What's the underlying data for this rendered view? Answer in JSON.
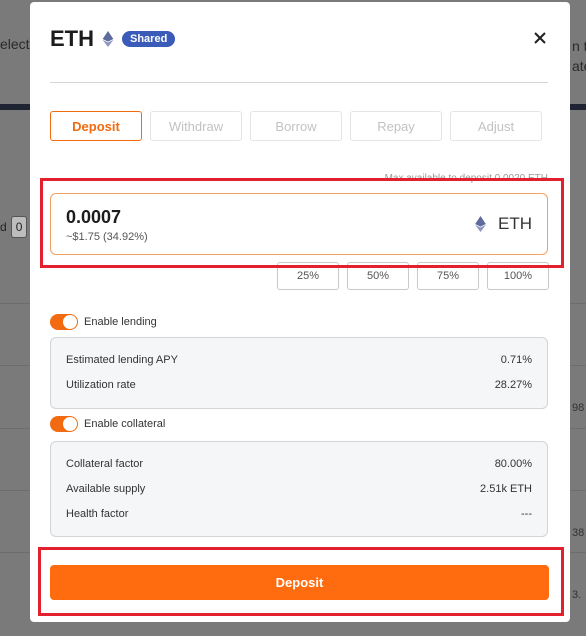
{
  "background": {
    "left_text": "elect",
    "left_chip_label": "d",
    "left_chip_value": "0",
    "right_text_1": "n t",
    "right_text_2": "ate",
    "right_nums": [
      "98",
      "38",
      "3."
    ]
  },
  "modal": {
    "title": "ETH",
    "badge": "Shared",
    "tabs": [
      "Deposit",
      "Withdraw",
      "Borrow",
      "Repay",
      "Adjust"
    ],
    "max_text": "Max available to deposit 0.0020 ETH",
    "amount": {
      "value": "0.0007",
      "usd": "~$1.75 (34.92%)",
      "currency": "ETH"
    },
    "percent_buttons": [
      "25%",
      "50%",
      "75%",
      "100%"
    ],
    "lending": {
      "toggle_label": "Enable lending",
      "rows": [
        {
          "label": "Estimated lending APY",
          "value": "0.71%"
        },
        {
          "label": "Utilization rate",
          "value": "28.27%"
        }
      ]
    },
    "collateral": {
      "toggle_label": "Enable collateral",
      "rows": [
        {
          "label": "Collateral factor",
          "value": "80.00%"
        },
        {
          "label": "Available supply",
          "value": "2.51k ETH"
        },
        {
          "label": "Health factor",
          "value": "---"
        }
      ]
    },
    "submit_label": "Deposit"
  },
  "colors": {
    "accent": "#ff6b0f",
    "badge": "#3b5bb8",
    "highlight": "#e3202e"
  }
}
